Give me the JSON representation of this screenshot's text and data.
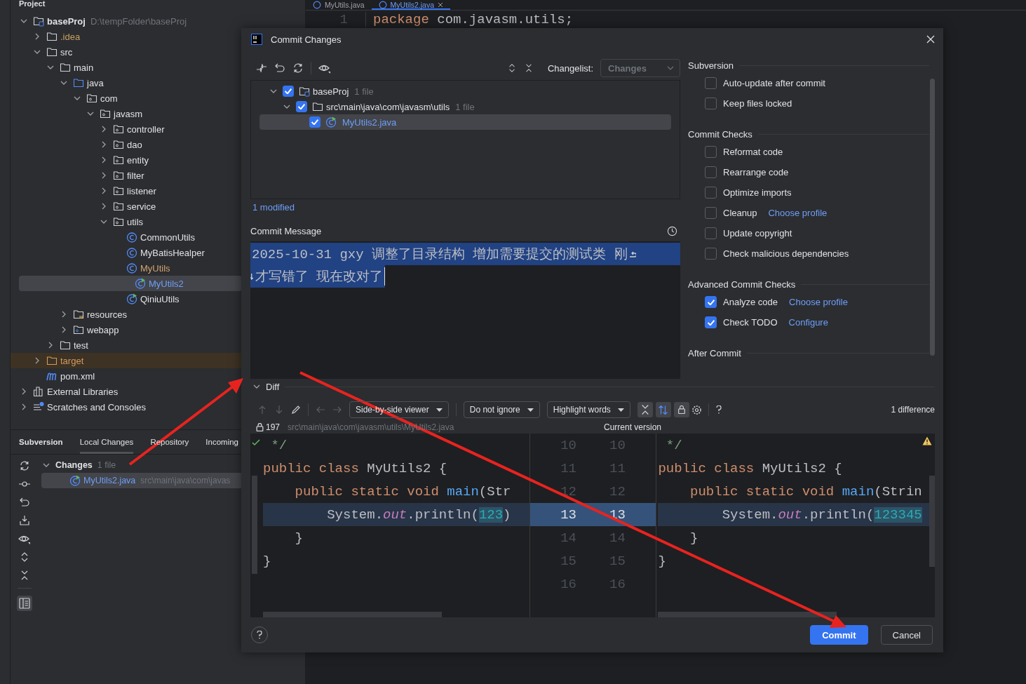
{
  "project": {
    "title": "Project",
    "tree": [
      {
        "label": "baseProj",
        "hint": "D:\\tempFolder\\baseProj",
        "kind": "module",
        "color": "#dfe1e5",
        "expanded": true,
        "selected": false,
        "children": [
          {
            "label": ".idea",
            "kind": "folder",
            "color": "#c9a063",
            "expanded": false,
            "selected": false
          },
          {
            "label": "src",
            "kind": "folder",
            "color": "#dfe1e5",
            "expanded": true,
            "selected": false,
            "children": [
              {
                "label": "main",
                "kind": "folder",
                "color": "#dfe1e5",
                "expanded": true,
                "selected": false,
                "children": [
                  {
                    "label": "java",
                    "kind": "source-folder",
                    "color": "#dfe1e5",
                    "expanded": true,
                    "selected": false,
                    "children": [
                      {
                        "label": "com",
                        "kind": "package",
                        "color": "#dfe1e5",
                        "expanded": true,
                        "selected": false,
                        "children": [
                          {
                            "label": "javasm",
                            "kind": "package",
                            "color": "#dfe1e5",
                            "expanded": true,
                            "selected": false,
                            "children": [
                              {
                                "label": "controller",
                                "kind": "package",
                                "color": "#dfe1e5",
                                "expanded": false,
                                "selected": false
                              },
                              {
                                "label": "dao",
                                "kind": "package",
                                "color": "#dfe1e5",
                                "expanded": false,
                                "selected": false
                              },
                              {
                                "label": "entity",
                                "kind": "package",
                                "color": "#dfe1e5",
                                "expanded": false,
                                "selected": false
                              },
                              {
                                "label": "filter",
                                "kind": "package",
                                "color": "#dfe1e5",
                                "expanded": false,
                                "selected": false
                              },
                              {
                                "label": "listener",
                                "kind": "package",
                                "color": "#dfe1e5",
                                "expanded": false,
                                "selected": false
                              },
                              {
                                "label": "service",
                                "kind": "package",
                                "color": "#dfe1e5",
                                "expanded": false,
                                "selected": false
                              },
                              {
                                "label": "utils",
                                "kind": "package",
                                "color": "#dfe1e5",
                                "expanded": true,
                                "selected": false,
                                "children": [
                                  {
                                    "label": "CommonUtils",
                                    "kind": "class",
                                    "color": "#dfe1e5",
                                    "selected": false
                                  },
                                  {
                                    "label": "MyBatisHealper",
                                    "kind": "class",
                                    "color": "#dfe1e5",
                                    "selected": false
                                  },
                                  {
                                    "label": "MyUtils",
                                    "kind": "class",
                                    "color": "#d3a36f",
                                    "selected": false
                                  },
                                  {
                                    "label": "MyUtils2",
                                    "kind": "runnable-class",
                                    "color": "#6f9ef8",
                                    "selected": true
                                  },
                                  {
                                    "label": "QiniuUtils",
                                    "kind": "runnable-class",
                                    "color": "#dfe1e5",
                                    "selected": false
                                  }
                                ]
                              }
                            ]
                          }
                        ]
                      }
                    ]
                  },
                  {
                    "label": "resources",
                    "kind": "resources-folder",
                    "color": "#dfe1e5",
                    "expanded": false,
                    "selected": false
                  },
                  {
                    "label": "webapp",
                    "kind": "web-folder",
                    "color": "#dfe1e5",
                    "expanded": false,
                    "selected": false
                  }
                ]
              },
              {
                "label": "test",
                "kind": "folder",
                "color": "#dfe1e5",
                "expanded": false,
                "selected": false
              }
            ]
          },
          {
            "label": "target",
            "kind": "excluded-folder",
            "color": "#d39a5f",
            "expanded": false,
            "selected": false
          },
          {
            "label": "pom.xml",
            "kind": "maven-file",
            "color": "#dfe1e5",
            "selected": false
          }
        ]
      },
      {
        "label": "External Libraries",
        "kind": "library",
        "color": "#dfe1e5",
        "expanded": false,
        "selected": false
      },
      {
        "label": "Scratches and Consoles",
        "kind": "scratches",
        "color": "#dfe1e5",
        "expanded": false,
        "selected": false
      }
    ]
  },
  "editor": {
    "tabs": [
      {
        "label": "MyUtils.java",
        "selected": false
      },
      {
        "label": "MyUtils2.java",
        "selected": true
      }
    ],
    "line": {
      "number": "1",
      "tokens": [
        {
          "text": "package",
          "kind": "kw"
        },
        {
          "text": " com.javasm.utils;",
          "kind": "plain"
        }
      ]
    }
  },
  "vcs_panel": {
    "title": "Subversion",
    "tabs": [
      {
        "label": "Local Changes",
        "selected": true
      },
      {
        "label": "Repository",
        "selected": false
      },
      {
        "label": "Incoming",
        "selected": false
      }
    ],
    "changes": {
      "label": "Changes",
      "count": "1 file",
      "expanded": true,
      "files": [
        {
          "name": "MyUtils2.java",
          "path": "src\\main\\java\\com\\javas",
          "selected": true
        }
      ]
    }
  },
  "dialog": {
    "title": "Commit Changes",
    "changelist": {
      "label": "Changelist:",
      "value": "Changes"
    },
    "files": [
      {
        "label": "baseProj",
        "count": "1 file",
        "kind": "module",
        "checked": true,
        "expanded": true,
        "selected": false,
        "children": [
          {
            "label": "src\\main\\java\\com\\javasm\\utils",
            "count": "1 file",
            "kind": "folder",
            "checked": true,
            "expanded": true,
            "selected": false,
            "children": [
              {
                "label": "MyUtils2.java",
                "kind": "runnable-class",
                "checked": true,
                "selected": true
              }
            ]
          }
        ]
      }
    ],
    "summary": "1 modified",
    "message": {
      "label": "Commit Message",
      "lines": [
        "2025-10-31 gxy 调整了目录结构 增加需要提交的测试类 刚",
        "才写错了 现在改对了"
      ]
    },
    "sections": [
      {
        "title": "Subversion",
        "options": [
          {
            "label": "Auto-update after commit",
            "checked": false
          },
          {
            "label": "Keep files locked",
            "checked": false
          }
        ]
      },
      {
        "title": "Commit Checks",
        "options": [
          {
            "label": "Reformat code",
            "checked": false
          },
          {
            "label": "Rearrange code",
            "checked": false
          },
          {
            "label": "Optimize imports",
            "checked": false
          },
          {
            "label": "Cleanup",
            "checked": false,
            "link": "Choose profile"
          },
          {
            "label": "Update copyright",
            "checked": false
          },
          {
            "label": "Check malicious dependencies",
            "checked": false
          }
        ]
      },
      {
        "title": "Advanced Commit Checks",
        "options": [
          {
            "label": "Analyze code",
            "checked": true,
            "link": "Choose profile"
          },
          {
            "label": "Check TODO",
            "checked": true,
            "link": "Configure"
          }
        ]
      },
      {
        "title": "After Commit"
      }
    ],
    "diff": {
      "title": "Diff",
      "expanded": true,
      "viewer": "Side-by-side viewer",
      "ignore": "Do not ignore",
      "highlight": "Highlight words",
      "count": "1 difference",
      "lock_count": "197",
      "path": "src\\main\\java\\com\\javasm\\utils\\MyUtils2.java",
      "right_title": "Current version",
      "lines": [
        {
          "left_number": "10",
          "right_number": "10",
          "changed": false,
          "left": [
            {
              "text": " */",
              "kind": "comment"
            }
          ],
          "right": [
            {
              "text": " */",
              "kind": "comment"
            }
          ]
        },
        {
          "left_number": "11",
          "right_number": "11",
          "changed": false,
          "left": [
            {
              "text": "public class ",
              "kind": "kw"
            },
            {
              "text": "MyUtils2 {",
              "kind": "plain"
            }
          ],
          "right": [
            {
              "text": "public class ",
              "kind": "kw"
            },
            {
              "text": "MyUtils2 {",
              "kind": "plain"
            }
          ]
        },
        {
          "left_number": "12",
          "right_number": "12",
          "changed": false,
          "left": [
            {
              "text": "    public static void ",
              "kind": "kw"
            },
            {
              "text": "main",
              "kind": "fn"
            },
            {
              "text": "(Str",
              "kind": "plain"
            }
          ],
          "right": [
            {
              "text": "    public static void ",
              "kind": "kw"
            },
            {
              "text": "main",
              "kind": "fn"
            },
            {
              "text": "(Strin",
              "kind": "plain"
            }
          ]
        },
        {
          "left_number": "13",
          "right_number": "13",
          "changed": true,
          "left": [
            {
              "text": "        System.",
              "kind": "plain"
            },
            {
              "text": "out",
              "kind": "field"
            },
            {
              "text": ".println(",
              "kind": "plain"
            },
            {
              "text": "123",
              "kind": "num-changed"
            },
            {
              "text": ")",
              "kind": "plain"
            }
          ],
          "right": [
            {
              "text": "        System.",
              "kind": "plain"
            },
            {
              "text": "out",
              "kind": "field"
            },
            {
              "text": ".println(",
              "kind": "plain"
            },
            {
              "text": "123345",
              "kind": "num-changed"
            }
          ]
        },
        {
          "left_number": "14",
          "right_number": "14",
          "changed": false,
          "left": [
            {
              "text": "    }",
              "kind": "plain"
            }
          ],
          "right": [
            {
              "text": "    }",
              "kind": "plain"
            }
          ]
        },
        {
          "left_number": "15",
          "right_number": "15",
          "changed": false,
          "left": [
            {
              "text": "}",
              "kind": "plain"
            }
          ],
          "right": [
            {
              "text": "}",
              "kind": "plain"
            }
          ]
        },
        {
          "left_number": "16",
          "right_number": "16",
          "changed": false
        }
      ]
    },
    "buttons": [
      {
        "label": "Commit",
        "kind": "primary"
      },
      {
        "label": "Cancel",
        "kind": "secondary"
      }
    ]
  }
}
